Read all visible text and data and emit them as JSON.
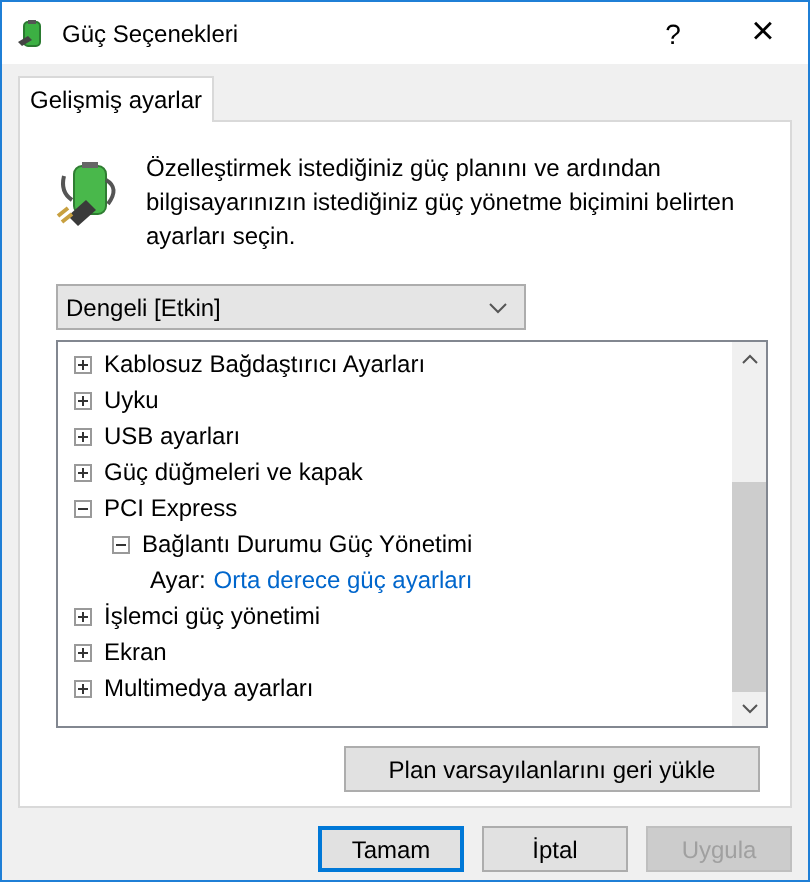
{
  "window": {
    "title": "Güç Seçenekleri",
    "help": "?",
    "close": "×"
  },
  "tabs": [
    {
      "label": "Gelişmiş ayarlar",
      "selected": true
    }
  ],
  "description": "Özelleştirmek istediğiniz güç planını ve ardından bilgisayarınızın istediğiniz güç yönetme biçimini belirten ayarları seçin.",
  "plan_dropdown": {
    "value": "Dengeli [Etkin]"
  },
  "tree": [
    {
      "kind": "group",
      "label": "Kablosuz Bağdaştırıcı Ayarları",
      "expanded": false
    },
    {
      "kind": "group",
      "label": "Uyku",
      "expanded": false
    },
    {
      "kind": "group",
      "label": "USB ayarları",
      "expanded": false
    },
    {
      "kind": "group",
      "label": "Güç düğmeleri ve kapak",
      "expanded": false
    },
    {
      "kind": "group",
      "label": "PCI Express",
      "expanded": true,
      "children": [
        {
          "kind": "group",
          "label": "Bağlantı Durumu Güç Yönetimi",
          "expanded": true,
          "children": [
            {
              "kind": "setting",
              "label": "Ayar:",
              "value": "Orta derece güç ayarları"
            }
          ]
        }
      ]
    },
    {
      "kind": "group",
      "label": "İşlemci güç yönetimi",
      "expanded": false
    },
    {
      "kind": "group",
      "label": "Ekran",
      "expanded": false
    },
    {
      "kind": "group",
      "label": "Multimedya ayarları",
      "expanded": false
    }
  ],
  "restore_button": "Plan varsayılanlarını geri yükle",
  "buttons": [
    {
      "label": "Tamam",
      "default": true,
      "disabled": false
    },
    {
      "label": "İptal",
      "default": false,
      "disabled": false
    },
    {
      "label": "Uygula",
      "default": false,
      "disabled": true
    }
  ]
}
